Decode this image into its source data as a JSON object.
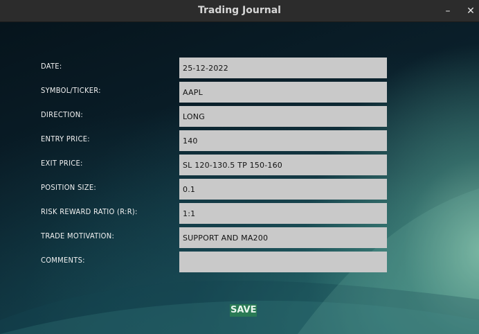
{
  "window": {
    "title": "Trading Journal",
    "minimize_glyph": "–",
    "close_glyph": "✕"
  },
  "form": {
    "fields": [
      {
        "label": "DATE:",
        "value": "25-12-2022"
      },
      {
        "label": "SYMBOL/TICKER:",
        "value": "AAPL"
      },
      {
        "label": "DIRECTION:",
        "value": "LONG"
      },
      {
        "label": "ENTRY PRICE:",
        "value": "140"
      },
      {
        "label": "EXIT PRICE:",
        "value": "SL 120-130.5 TP 150-160"
      },
      {
        "label": "POSITION SIZE:",
        "value": "0.1"
      },
      {
        "label": "RISK REWARD RATIO (R:R):",
        "value": "1:1"
      },
      {
        "label": "TRADE MOTIVATION:",
        "value": "SUPPORT AND MA200"
      },
      {
        "label": "COMMENTS:",
        "value": ""
      }
    ],
    "save_label": "SAVE"
  },
  "colors": {
    "field_bg": "#c9c9c9",
    "save_bg": "#2a7a55",
    "titlebar_bg": "#2c2c2c"
  }
}
